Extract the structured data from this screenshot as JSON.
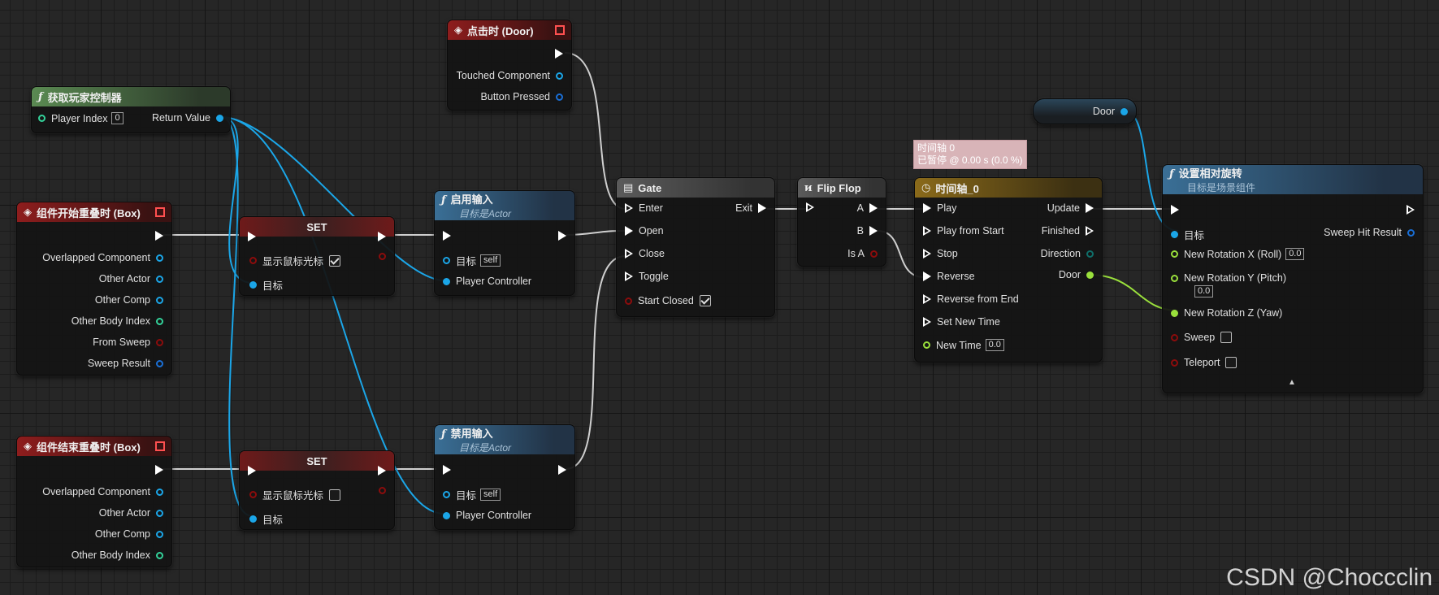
{
  "nodes": {
    "get_controller": {
      "title": "获取玩家控制器",
      "player_index_label": "Player Index",
      "player_index_value": "0",
      "return_label": "Return Value"
    },
    "on_begin": {
      "title": "组件开始重叠时 (Box)",
      "pins": [
        "Overlapped Component",
        "Other Actor",
        "Other Comp",
        "Other Body Index",
        "From Sweep",
        "Sweep Result"
      ]
    },
    "on_end": {
      "title": "组件结束重叠时 (Box)",
      "pins": [
        "Overlapped Component",
        "Other Actor",
        "Other Comp",
        "Other Body Index"
      ]
    },
    "set1": {
      "title": "SET",
      "show_cursor_label": "显示鼠标光标",
      "target_label": "目标"
    },
    "set2": {
      "title": "SET",
      "show_cursor_label": "显示鼠标光标",
      "target_label": "目标"
    },
    "enable_input": {
      "title": "启用输入",
      "subtitle": "目标是Actor",
      "target_label": "目标",
      "target_value": "self",
      "controller_label": "Player Controller"
    },
    "disable_input": {
      "title": "禁用输入",
      "subtitle": "目标是Actor",
      "target_label": "目标",
      "target_value": "self",
      "controller_label": "Player Controller"
    },
    "on_click": {
      "title": "点击时 (Door)",
      "pins": [
        "Touched Component",
        "Button Pressed"
      ]
    },
    "gate": {
      "title": "Gate",
      "inputs": [
        "Enter",
        "Open",
        "Close",
        "Toggle"
      ],
      "start_closed": "Start Closed",
      "exit": "Exit"
    },
    "flipflop": {
      "title": "Flip Flop",
      "outputs": [
        "A",
        "B",
        "Is A"
      ]
    },
    "timeline": {
      "title": "时间轴_0",
      "inputs": [
        "Play",
        "Play from Start",
        "Stop",
        "Reverse",
        "Reverse from End",
        "Set New Time"
      ],
      "new_time_label": "New Time",
      "new_time_value": "0.0",
      "outputs": [
        "Update",
        "Finished",
        "Direction",
        "Door"
      ],
      "tooltip_line1": "时间轴 0",
      "tooltip_line2": "已暂停 @ 0.00 s (0.0 %)"
    },
    "door_var": {
      "title": "Door"
    },
    "set_rotation": {
      "title": "设置相对旋转",
      "subtitle": "目标是场景组件",
      "target_label": "目标",
      "sweep_hit": "Sweep Hit Result",
      "rot_x": "New Rotation X (Roll)",
      "rot_x_value": "0.0",
      "rot_y": "New Rotation Y (Pitch)",
      "rot_y_value": "0.0",
      "rot_z": "New Rotation Z (Yaw)",
      "sweep": "Sweep",
      "teleport": "Teleport"
    }
  },
  "watermark": "CSDN @Choccclin",
  "colors": {
    "exec": "#ffffff",
    "object": "#1ba6e8",
    "bool": "#8c0c0c",
    "int": "#33d29a",
    "float": "#9ae03c",
    "struct": "#1a6fd6",
    "wire_exec": "#d0d0d0"
  }
}
